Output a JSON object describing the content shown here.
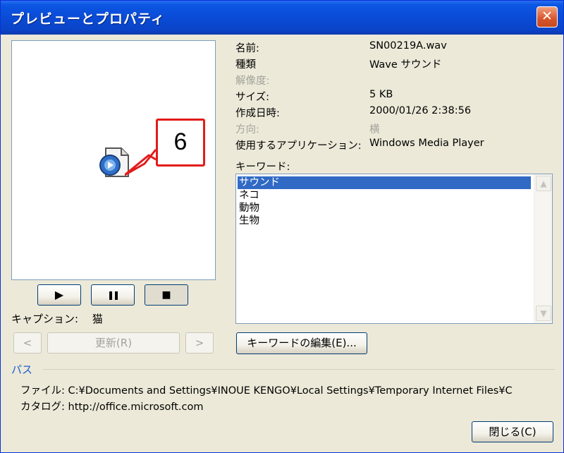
{
  "window": {
    "title": "プレビューとプロパティ",
    "close_glyph": "✕"
  },
  "preview": {
    "icon": "media-file-icon",
    "callout_number": "6",
    "controls": [
      {
        "name": "play",
        "glyph": "▶"
      },
      {
        "name": "pause",
        "glyph": "❚❚"
      },
      {
        "name": "stop",
        "glyph": "■"
      }
    ],
    "caption_label": "キャプション:",
    "caption_value": "猫",
    "prev_glyph": "<",
    "update_label": "更新(R)",
    "next_glyph": ">"
  },
  "properties": [
    {
      "key": "名前:",
      "value": "SN00219A.wav",
      "enabled": true
    },
    {
      "key": "種類",
      "value": "Wave サウンド",
      "enabled": true
    },
    {
      "key": "解像度:",
      "value": "",
      "enabled": false
    },
    {
      "key": "サイズ:",
      "value": "5 KB",
      "enabled": true
    },
    {
      "key": "作成日時:",
      "value": "2000/01/26 2:38:56",
      "enabled": true
    },
    {
      "key": "方向:",
      "value": "横",
      "enabled": false
    },
    {
      "key": "使用するアプリケーション:",
      "value": "Windows Media Player",
      "enabled": true
    }
  ],
  "keywords": {
    "label": "キーワード:",
    "items": [
      "サウンド",
      "ネコ",
      "動物",
      "生物"
    ],
    "selected_index": 0,
    "edit_button": "キーワードの編集(E)..."
  },
  "path": {
    "section_label": "パス",
    "file_label": "ファイル:",
    "file_value": "C:¥Documents and Settings¥INOUE KENGO¥Local Settings¥Temporary Internet Files¥C",
    "catalog_label": "カタログ:",
    "catalog_value": "http://office.microsoft.com"
  },
  "close_button": "閉じる(C)",
  "colors": {
    "titlebar": "#0a4bd6",
    "callout_border": "#e31b1b",
    "selection": "#316ac5",
    "section_label": "#1c5ccf"
  }
}
